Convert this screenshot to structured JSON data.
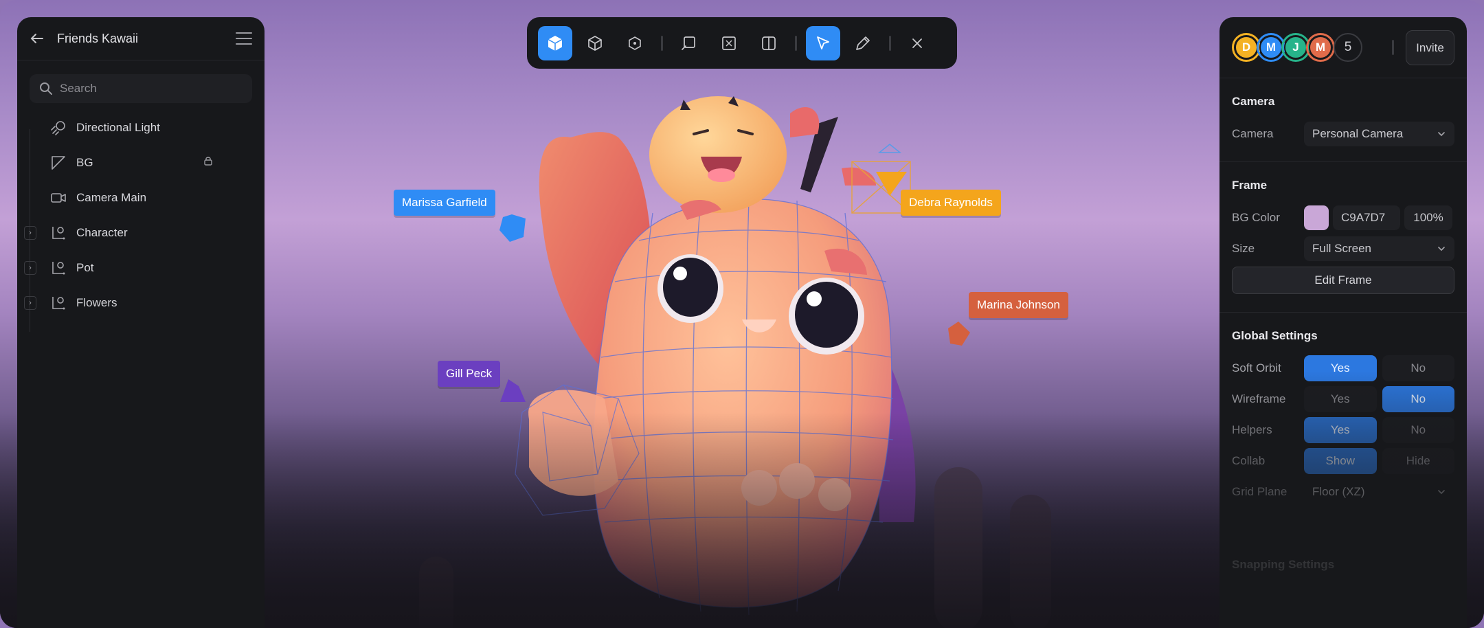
{
  "project": {
    "title": "Friends Kawaii"
  },
  "search": {
    "placeholder": "Search"
  },
  "layers": [
    {
      "label": "Directional Light",
      "icon": "directional-light-icon",
      "expandable": false,
      "locked": false
    },
    {
      "label": "BG",
      "icon": "plane-icon",
      "expandable": false,
      "locked": true
    },
    {
      "label": "Camera Main",
      "icon": "camera-icon",
      "expandable": false,
      "locked": false
    },
    {
      "label": "Character",
      "icon": "group-icon",
      "expandable": true,
      "locked": false
    },
    {
      "label": "Pot",
      "icon": "group-icon",
      "expandable": true,
      "locked": false
    },
    {
      "label": "Flowers",
      "icon": "group-icon",
      "expandable": true,
      "locked": false
    }
  ],
  "toolbar": {
    "tools": [
      "solid-view-icon",
      "wireframe-view-icon",
      "vertex-view-icon",
      "frame-tool-icon",
      "scale-tool-icon",
      "split-view-icon",
      "select-tool-icon",
      "pen-tool-icon",
      "close-icon"
    ],
    "active": [
      "solid-view-icon",
      "select-tool-icon"
    ]
  },
  "collaborators": [
    {
      "initial": "D",
      "color": "#f4b224"
    },
    {
      "initial": "M",
      "color": "#2f8cf5"
    },
    {
      "initial": "J",
      "color": "#27b38a"
    },
    {
      "initial": "M",
      "color": "#e06b4a"
    }
  ],
  "collaborator_count": "5",
  "invite_label": "Invite",
  "camera": {
    "heading": "Camera",
    "camera_label": "Camera",
    "camera_value": "Personal Camera"
  },
  "frame": {
    "heading": "Frame",
    "bg_color_label": "BG Color",
    "bg_color_hex": "C9A7D7",
    "bg_color_swatch": "#c9a7d7",
    "bg_opacity": "100%",
    "size_label": "Size",
    "size_value": "Full Screen",
    "edit_label": "Edit Frame"
  },
  "global_settings": {
    "heading": "Global Settings",
    "rows": [
      {
        "label": "Soft Orbit",
        "options": [
          "Yes",
          "No"
        ],
        "selected": "Yes"
      },
      {
        "label": "Wireframe",
        "options": [
          "Yes",
          "No"
        ],
        "selected": "No"
      },
      {
        "label": "Helpers",
        "options": [
          "Yes",
          "No"
        ],
        "selected": "Yes"
      },
      {
        "label": "Collab",
        "options": [
          "Show",
          "Hide"
        ],
        "selected": "Show"
      }
    ],
    "grid_plane_label": "Grid Plane",
    "grid_plane_value": "Floor (XZ)"
  },
  "snapping": {
    "heading": "Snapping Settings"
  },
  "cursors": [
    {
      "name": "Marissa Garfield",
      "color": "#2f8cf5"
    },
    {
      "name": "Debra Raynolds",
      "color": "#f4a51c"
    },
    {
      "name": "Marina Johnson",
      "color": "#d5603e"
    },
    {
      "name": "Gill Peck",
      "color": "#6b3fc0"
    }
  ],
  "accent": "#2f8cf5"
}
